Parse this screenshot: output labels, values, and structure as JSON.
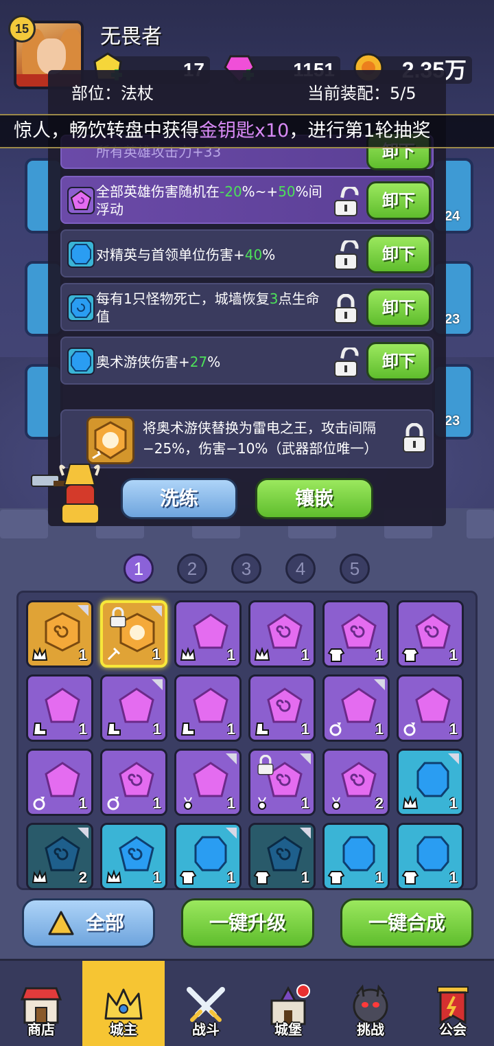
{
  "player": {
    "level": "15",
    "name": "无畏者"
  },
  "resources": {
    "gold": "17",
    "gems": "1151",
    "coins": "2.35万"
  },
  "popup": {
    "slot_label": "部位：法杖",
    "equip_label": "当前装配：5/5",
    "marquee": {
      "prefix": "惊人，畅饮转盘中获得",
      "highlight": "金钥匙x10",
      "suffix": "，进行第1轮抽奖"
    },
    "partial_row": "所有英雄攻击力+33",
    "attributes": [
      {
        "parts": [
          "全部英雄伤害随机在",
          "-20",
          "%~+",
          "50",
          "%间浮动"
        ],
        "lock": "unlocked",
        "button": "卸下",
        "gem": "purple-swirl"
      },
      {
        "parts": [
          "对精英与首领单位伤害+",
          "40",
          "%",
          "",
          ""
        ],
        "lock": "unlocked",
        "button": "卸下",
        "gem": "blue-square"
      },
      {
        "parts": [
          "每有1只怪物死亡，城墙恢复",
          "3",
          "点生命值",
          "",
          ""
        ],
        "lock": "locked",
        "button": "卸下",
        "gem": "blue-swirl"
      },
      {
        "parts": [
          "奥术游侠伤害+",
          "27",
          "%",
          "",
          ""
        ],
        "lock": "unlocked",
        "button": "卸下",
        "gem": "blue-square"
      }
    ],
    "partial_button": "卸下",
    "special": {
      "text": "将奥术游侠替换为雷电之王，攻击间隔−25%，伤害−10%（武器部位唯一）"
    },
    "refine_button": "洗练",
    "inlay_button": "镶嵌"
  },
  "pages": [
    "1",
    "2",
    "3",
    "4",
    "5"
  ],
  "active_page": 0,
  "side_levels": [
    "24",
    "23",
    "23"
  ],
  "inventory": [
    {
      "color": "gold",
      "gem": "swirl",
      "slot": "crown",
      "count": "1",
      "corner": true
    },
    {
      "color": "gold",
      "gem": "special",
      "slot": "weapon",
      "count": "1",
      "corner": true,
      "locked": true,
      "selected": true
    },
    {
      "color": "purple",
      "gem": "plain",
      "slot": "crown",
      "count": "1"
    },
    {
      "color": "purple",
      "gem": "swirl",
      "slot": "crown",
      "count": "1"
    },
    {
      "color": "purple",
      "gem": "swirl",
      "slot": "armor",
      "count": "1"
    },
    {
      "color": "purple",
      "gem": "swirl",
      "slot": "armor",
      "count": "1"
    },
    {
      "color": "purple",
      "gem": "plain",
      "slot": "boots",
      "count": "1"
    },
    {
      "color": "purple",
      "gem": "plain",
      "slot": "boots",
      "count": "1",
      "corner": true
    },
    {
      "color": "purple",
      "gem": "plain",
      "slot": "boots",
      "count": "1"
    },
    {
      "color": "purple",
      "gem": "swirl",
      "slot": "boots",
      "count": "1"
    },
    {
      "color": "purple",
      "gem": "plain",
      "slot": "ring",
      "count": "1",
      "corner": true
    },
    {
      "color": "purple",
      "gem": "plain",
      "slot": "ring",
      "count": "1"
    },
    {
      "color": "purple",
      "gem": "plain",
      "slot": "ring",
      "count": "1"
    },
    {
      "color": "purple",
      "gem": "swirl",
      "slot": "ring",
      "count": "1"
    },
    {
      "color": "purple",
      "gem": "plain",
      "slot": "amulet",
      "count": "1",
      "corner": true
    },
    {
      "color": "purple",
      "gem": "swirl",
      "slot": "amulet",
      "count": "1",
      "corner": true,
      "locked": true
    },
    {
      "color": "purple",
      "gem": "swirl",
      "slot": "amulet",
      "count": "2"
    },
    {
      "color": "blue",
      "gem": "square",
      "slot": "crown",
      "count": "1",
      "corner": true
    },
    {
      "color": "darkblue",
      "gem": "swirl",
      "slot": "crown",
      "count": "2",
      "corner": true
    },
    {
      "color": "blue",
      "gem": "swirl",
      "slot": "crown",
      "count": "1"
    },
    {
      "color": "blue",
      "gem": "square",
      "slot": "armor",
      "count": "1",
      "corner": true
    },
    {
      "color": "darkblue",
      "gem": "swirl",
      "slot": "armor",
      "count": "1",
      "corner": true
    },
    {
      "color": "blue",
      "gem": "square",
      "slot": "armor",
      "count": "1"
    },
    {
      "color": "blue",
      "gem": "square",
      "slot": "armor",
      "count": "1"
    }
  ],
  "bottom_buttons": {
    "all": "全部",
    "upgrade": "一键升级",
    "merge": "一键合成"
  },
  "nav": [
    {
      "label": "商店",
      "icon": "shop-icon"
    },
    {
      "label": "城主",
      "icon": "lord-crown-icon",
      "active": true
    },
    {
      "label": "战斗",
      "icon": "battle-swords-icon"
    },
    {
      "label": "城堡",
      "icon": "castle-icon"
    },
    {
      "label": "挑战",
      "icon": "challenge-monster-icon"
    },
    {
      "label": "公会",
      "icon": "guild-banner-icon"
    }
  ],
  "colors": {
    "purple_gem": "#e46cf0",
    "blue_gem": "#2a9df2",
    "gold_cell": "#e0a336",
    "green_btn": "#6cc63a",
    "accent_yellow": "#f6c533"
  }
}
